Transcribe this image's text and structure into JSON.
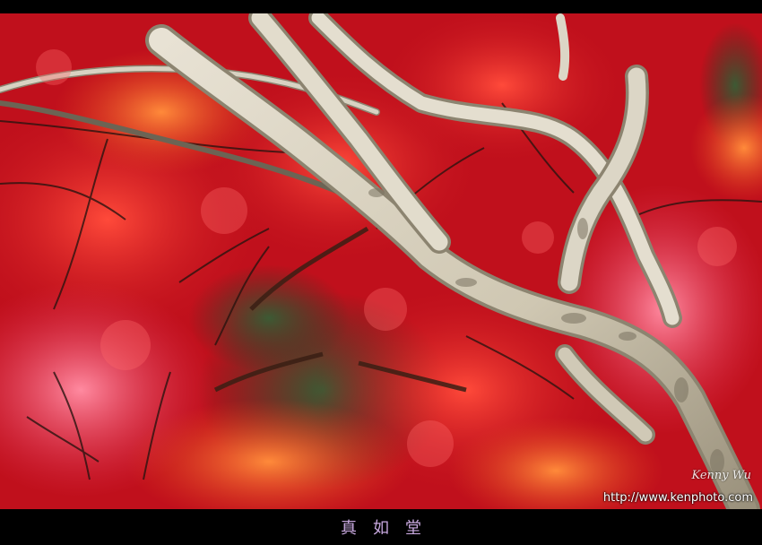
{
  "photo": {
    "subject": "maple-tree-branches",
    "colors": {
      "leaf_red": "#d4121d",
      "leaf_deep": "#a0081a",
      "leaf_orange": "#f2542a",
      "leaf_pink": "#f06a7a",
      "bark": "#d8d2c2",
      "bark_shadow": "#8c8470",
      "background_green": "#2f4a2a"
    }
  },
  "watermark": {
    "signature": "Kenny Wu",
    "url": "http://www.kenphoto.com"
  },
  "caption": {
    "title": "真如堂"
  }
}
